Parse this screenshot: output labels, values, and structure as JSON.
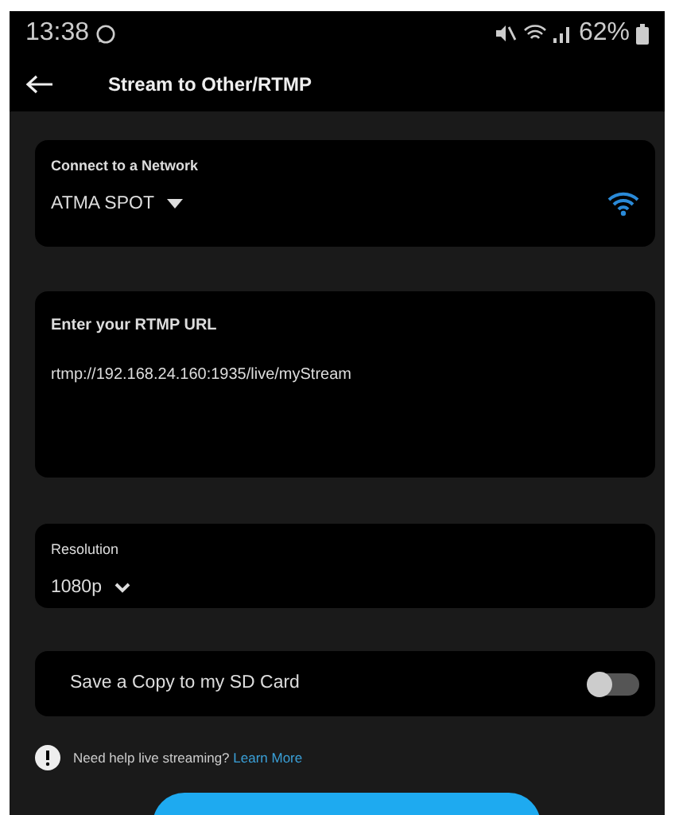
{
  "status_bar": {
    "time": "13:38",
    "battery": "62%"
  },
  "header": {
    "title": "Stream to Other/RTMP"
  },
  "network": {
    "label": "Connect to a Network",
    "value": "ATMA SPOT"
  },
  "rtmp": {
    "label": "Enter your RTMP URL",
    "value": "rtmp://192.168.24.160:1935/live/myStream"
  },
  "resolution": {
    "label": "Resolution",
    "value": "1080p"
  },
  "sd_card": {
    "label": "Save a Copy to my SD Card",
    "on": false
  },
  "help": {
    "text": "Need help live streaming?",
    "link": "Learn More"
  }
}
